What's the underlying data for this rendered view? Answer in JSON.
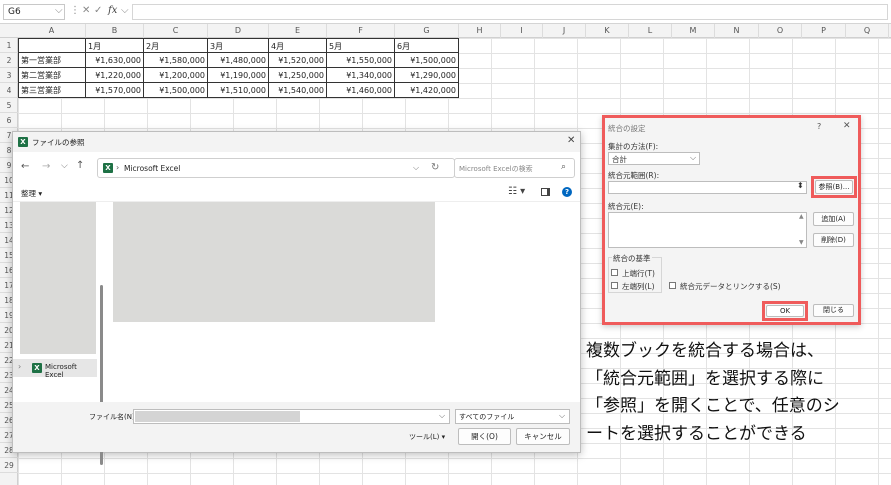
{
  "formula_bar": {
    "name_box": "G6",
    "fx": "fx"
  },
  "grid": {
    "columns": [
      "A",
      "B",
      "C",
      "D",
      "E",
      "F",
      "G",
      "H",
      "I",
      "J",
      "K",
      "L",
      "M",
      "N",
      "O",
      "P",
      "Q"
    ],
    "rows": [
      "1",
      "2",
      "3",
      "4",
      "5",
      "6",
      "7",
      "8",
      "9",
      "10",
      "11",
      "12",
      "13",
      "14",
      "15",
      "16",
      "17",
      "18",
      "19",
      "20",
      "21",
      "22",
      "23",
      "24",
      "25",
      "26",
      "27",
      "28",
      "29"
    ],
    "table": {
      "header": [
        "",
        "1月",
        "2月",
        "3月",
        "4月",
        "5月",
        "6月"
      ],
      "body": [
        [
          "第一営業部",
          "¥1,630,000",
          "¥1,580,000",
          "¥1,480,000",
          "¥1,520,000",
          "¥1,550,000",
          "¥1,500,000"
        ],
        [
          "第二営業部",
          "¥1,220,000",
          "¥1,200,000",
          "¥1,190,000",
          "¥1,250,000",
          "¥1,340,000",
          "¥1,290,000"
        ],
        [
          "第三営業部",
          "¥1,570,000",
          "¥1,500,000",
          "¥1,510,000",
          "¥1,540,000",
          "¥1,460,000",
          "¥1,420,000"
        ]
      ]
    }
  },
  "file_dialog": {
    "title": "ファイルの参照",
    "address": "Microsoft Excel",
    "search_placeholder": "Microsoft Excelの検索",
    "organize": "整理 ▾",
    "sidebar_item": "Microsoft Excel",
    "filename_label": "ファイル名(N):",
    "filter": "すべてのファイル",
    "tools": "ツール(L)",
    "open": "開く(O)",
    "cancel": "キャンセル"
  },
  "consolidate_dialog": {
    "title": "統合の設定",
    "help": "?",
    "close": "✕",
    "function_label": "集計の方法(F):",
    "function_value": "合計",
    "reference_label": "統合元範囲(R):",
    "browse": "参照(B)...",
    "sources_label": "統合元(E):",
    "add": "追加(A)",
    "delete": "削除(D)",
    "labels_group": "統合の基準",
    "top_row": "上端行(T)",
    "left_column": "左端列(L)",
    "link_source": "統合元データとリンクする(S)",
    "ok": "OK",
    "close_button": "閉じる"
  },
  "caption": {
    "lines": [
      "複数ブックを統合する場合は、",
      "「統合元範囲」を選択する際に",
      "「参照」を開くことで、任意のシ",
      "ートを選択することができる"
    ]
  },
  "colors": {
    "highlight": "#ef5b5b",
    "excel_green": "#1e7145",
    "accent_blue": "#0067c0"
  }
}
